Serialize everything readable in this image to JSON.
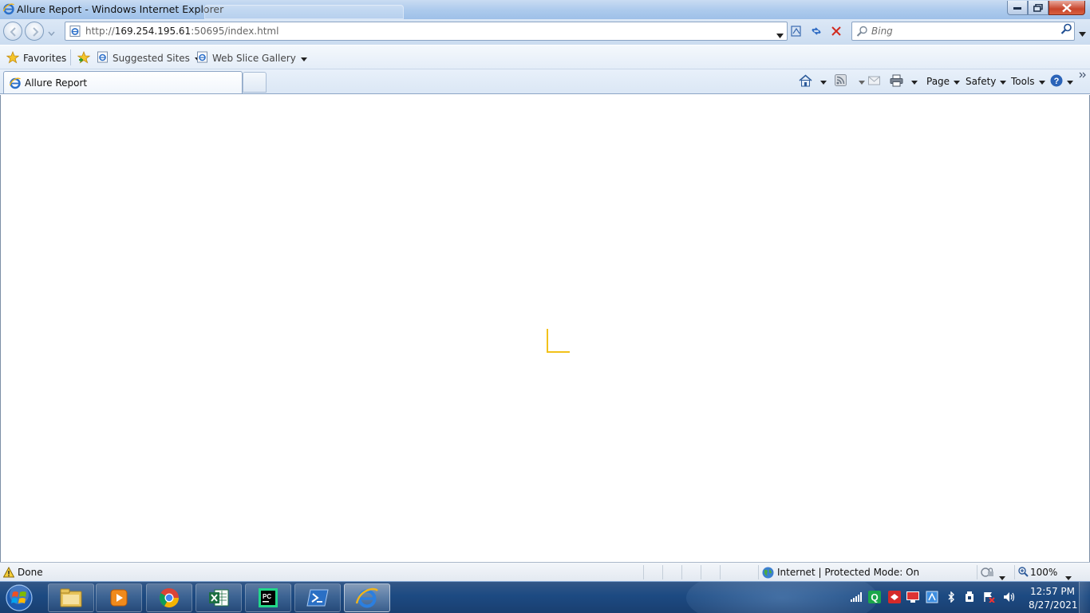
{
  "window": {
    "title": "Allure Report - Windows Internet Explorer"
  },
  "address_bar": {
    "url_prefix": "http://",
    "url_host": "169.254.195.61",
    "url_rest": ":50695/index.html"
  },
  "search": {
    "placeholder": "Bing"
  },
  "favorites_bar": {
    "favorites_label": "Favorites",
    "items": [
      {
        "label": "Suggested Sites"
      },
      {
        "label": "Web Slice Gallery"
      }
    ]
  },
  "tabs": [
    {
      "label": "Allure Report",
      "active": true
    }
  ],
  "command_bar": {
    "page_label": "Page",
    "safety_label": "Safety",
    "tools_label": "Tools"
  },
  "content": {
    "loader_color": "#f2c21a"
  },
  "status_bar": {
    "status_text": "Done",
    "zone_text": "Internet | Protected Mode: On",
    "zoom_text": "100%"
  },
  "taskbar": {
    "apps": [
      {
        "name": "windows-explorer",
        "active": false
      },
      {
        "name": "media-player",
        "active": false
      },
      {
        "name": "chrome",
        "active": false
      },
      {
        "name": "excel",
        "active": false
      },
      {
        "name": "pycharm",
        "active": false
      },
      {
        "name": "powershell",
        "active": false
      },
      {
        "name": "internet-explorer",
        "active": true
      }
    ],
    "clock": {
      "time": "12:57 PM",
      "date": "8/27/2021"
    }
  },
  "colors": {
    "accent": "#1c4a82",
    "loader": "#f2c21a",
    "close_button": "#c8452c"
  }
}
